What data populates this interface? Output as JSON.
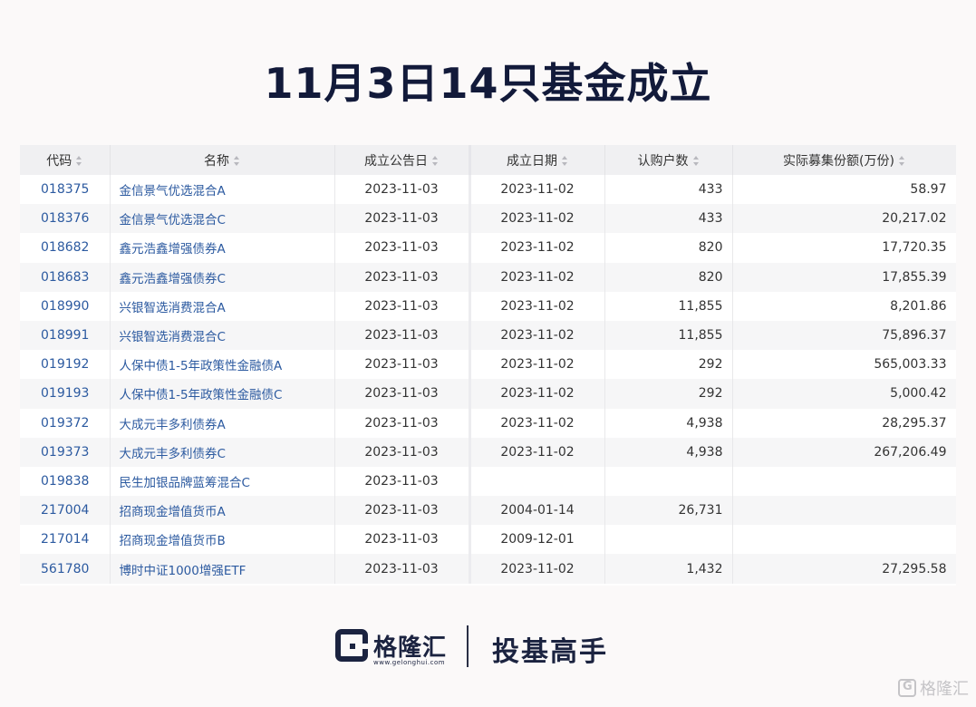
{
  "title": "11月3日14只基金成立",
  "table": {
    "headers": [
      "代码",
      "名称",
      "成立公告日",
      "成立日期",
      "认购户数",
      "实际募集份额(万份)"
    ],
    "rows": [
      [
        "018375",
        "金信景气优选混合A",
        "2023-11-03",
        "2023-11-02",
        "433",
        "58.97"
      ],
      [
        "018376",
        "金信景气优选混合C",
        "2023-11-03",
        "2023-11-02",
        "433",
        "20,217.02"
      ],
      [
        "018682",
        "鑫元浩鑫增强债券A",
        "2023-11-03",
        "2023-11-02",
        "820",
        "17,720.35"
      ],
      [
        "018683",
        "鑫元浩鑫增强债券C",
        "2023-11-03",
        "2023-11-02",
        "820",
        "17,855.39"
      ],
      [
        "018990",
        "兴银智选消费混合A",
        "2023-11-03",
        "2023-11-02",
        "11,855",
        "8,201.86"
      ],
      [
        "018991",
        "兴银智选消费混合C",
        "2023-11-03",
        "2023-11-02",
        "11,855",
        "75,896.37"
      ],
      [
        "019192",
        "人保中债1-5年政策性金融债A",
        "2023-11-03",
        "2023-11-02",
        "292",
        "565,003.33"
      ],
      [
        "019193",
        "人保中债1-5年政策性金融债C",
        "2023-11-03",
        "2023-11-02",
        "292",
        "5,000.42"
      ],
      [
        "019372",
        "大成元丰多利债券A",
        "2023-11-03",
        "2023-11-02",
        "4,938",
        "28,295.37"
      ],
      [
        "019373",
        "大成元丰多利债券C",
        "2023-11-03",
        "2023-11-02",
        "4,938",
        "267,206.49"
      ],
      [
        "019838",
        "民生加银品牌蓝筹混合C",
        "2023-11-03",
        "",
        "",
        ""
      ],
      [
        "217004",
        "招商现金增值货币A",
        "2023-11-03",
        "2004-01-14",
        "26,731",
        ""
      ],
      [
        "217014",
        "招商现金增值货币B",
        "2023-11-03",
        "2009-12-01",
        "",
        ""
      ],
      [
        "561780",
        "博时中证1000增强ETF",
        "2023-11-03",
        "2023-11-02",
        "1,432",
        "27,295.58"
      ]
    ]
  },
  "footer": {
    "brand": "格隆汇",
    "brand_url": "www.gelonghui.com",
    "slogan": "投基高手"
  },
  "watermark": "格隆汇",
  "icons": {
    "logo": "gelonghui-logo-icon",
    "sort": "sort-icon"
  },
  "colors": {
    "title": "#121a3a",
    "link": "#2c5aa0",
    "header_bg": "#f0f0f2",
    "stripe_bg": "#f6f6f7"
  }
}
